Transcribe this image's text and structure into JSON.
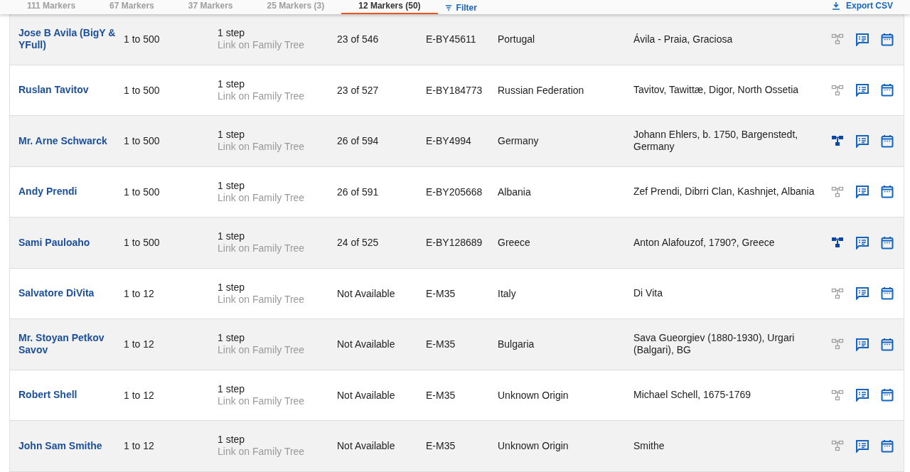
{
  "tabs": [
    {
      "label": "111 Markers",
      "selected": false
    },
    {
      "label": "67 Markers",
      "selected": false
    },
    {
      "label": "37 Markers",
      "selected": false
    },
    {
      "label": "25 Markers (3)",
      "selected": false
    },
    {
      "label": "12 Markers (50)",
      "selected": true
    }
  ],
  "filter_label": "Filter",
  "export_label": "Export CSV",
  "rows": [
    {
      "name": "Jose B Avila (BigY & YFull)",
      "range": "1 to 500",
      "steps": "1 step",
      "link": "Link on Family Tree",
      "rank": "23 of 546",
      "haplogroup": "E-BY45611",
      "country": "Portugal",
      "ancestor": "Ávila - Praia, Graciosa",
      "tree_linked": false
    },
    {
      "name": "Ruslan Tavitov",
      "range": "1 to 500",
      "steps": "1 step",
      "link": "Link on Family Tree",
      "rank": "23 of 527",
      "haplogroup": "E-BY184773",
      "country": "Russian Federation",
      "ancestor": "Tavitov, Tawittæ, Digor, North Ossetia",
      "tree_linked": false
    },
    {
      "name": "Mr. Arne Schwarck",
      "range": "1 to 500",
      "steps": "1 step",
      "link": "Link on Family Tree",
      "rank": "26 of 594",
      "haplogroup": "E-BY4994",
      "country": "Germany",
      "ancestor": "Johann Ehlers, b. 1750, Bargenstedt, Germany",
      "tree_linked": true
    },
    {
      "name": "Andy Prendi",
      "range": "1 to 500",
      "steps": "1 step",
      "link": "Link on Family Tree",
      "rank": "26 of 591",
      "haplogroup": "E-BY205668",
      "country": "Albania",
      "ancestor": "Zef Prendi, Dibrri Clan, Kashnjet, Albania",
      "tree_linked": false
    },
    {
      "name": "Sami Pauloaho",
      "range": "1 to 500",
      "steps": "1 step",
      "link": "Link on Family Tree",
      "rank": "24 of 525",
      "haplogroup": "E-BY128689",
      "country": "Greece",
      "ancestor": "Anton Alafouzof, 1790?, Greece",
      "tree_linked": true
    },
    {
      "name": "Salvatore DiVita",
      "range": "1 to 12",
      "steps": "1 step",
      "link": "Link on Family Tree",
      "rank": "Not Available",
      "haplogroup": "E-M35",
      "country": "Italy",
      "ancestor": "Di Vita",
      "tree_linked": false
    },
    {
      "name": "Mr. Stoyan Petkov Savov",
      "range": "1 to 12",
      "steps": "1 step",
      "link": "Link on Family Tree",
      "rank": "Not Available",
      "haplogroup": "E-M35",
      "country": "Bulgaria",
      "ancestor": "Sava Gueorgiev (1880-1930), Urgari (Balgari), BG",
      "tree_linked": false
    },
    {
      "name": "Robert Shell",
      "range": "1 to 12",
      "steps": "1 step",
      "link": "Link on Family Tree",
      "rank": "Not Available",
      "haplogroup": "E-M35",
      "country": "Unknown Origin",
      "ancestor": "Michael Schell, 1675-1769",
      "tree_linked": false
    },
    {
      "name": "John Sam Smithe",
      "range": "1 to 12",
      "steps": "1 step",
      "link": "Link on Family Tree",
      "rank": "Not Available",
      "haplogroup": "E-M35",
      "country": "Unknown Origin",
      "ancestor": "Smithe",
      "tree_linked": false
    }
  ]
}
